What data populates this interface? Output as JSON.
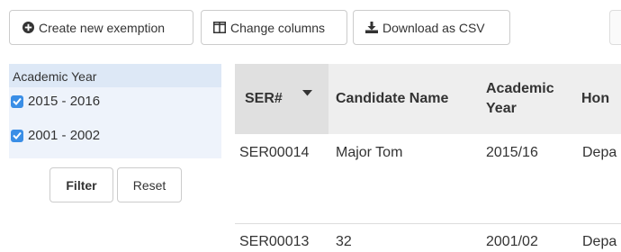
{
  "toolbar": {
    "create_label": "Create new exemption",
    "columns_label": "Change columns",
    "csv_label": "Download as CSV"
  },
  "filter": {
    "title": "Academic Year",
    "options": [
      {
        "label": "2015 - 2016",
        "checked": true
      },
      {
        "label": "2001 - 2002",
        "checked": true
      }
    ],
    "filter_label": "Filter",
    "reset_label": "Reset"
  },
  "table": {
    "columns": [
      "SER#",
      "Candidate Name",
      "Academic Year",
      "Hon"
    ],
    "sorted_column": "SER#",
    "sort_direction": "descending",
    "rows": [
      [
        "SER00014",
        "Major Tom",
        "2015/16",
        "Depa"
      ],
      [
        "SER00013",
        "32",
        "2001/02",
        "Depa"
      ]
    ]
  },
  "colors": {
    "checkbox": "#3a8ee6",
    "filter_panel_bg": "#eef3fb",
    "filter_header_bg": "#dde8f6",
    "table_header_bg": "#eeeeee",
    "sorted_header_bg": "#e0e0e0"
  },
  "icons": {
    "create": "plus-circle-icon",
    "columns": "columns-icon",
    "csv": "download-icon",
    "sort": "caret-down-icon",
    "check": "check-icon"
  }
}
